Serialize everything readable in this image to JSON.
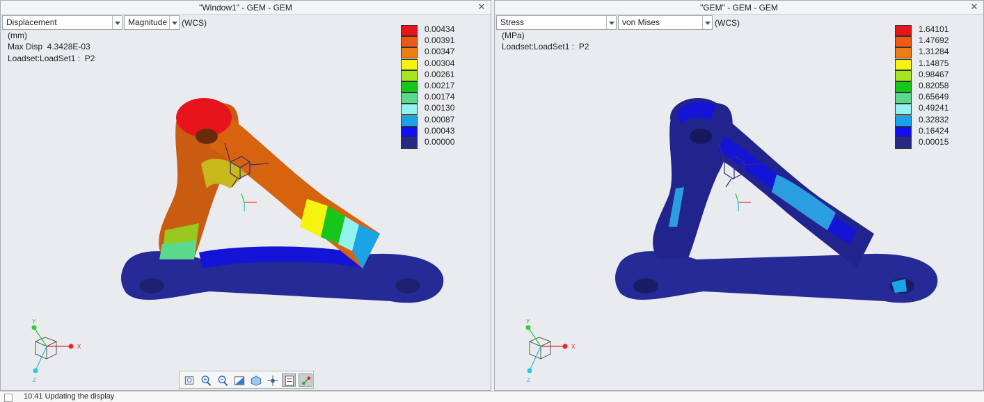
{
  "left": {
    "title": "\"Window1\" - GEM - GEM",
    "quantity": "Displacement",
    "component": "Magnitude",
    "coord_system": "(WCS)",
    "units": "(mm)",
    "max_label": "Max Disp  4.3428E-03",
    "loadset": "Loadset:LoadSet1 :  P2",
    "legend": {
      "values": [
        "0.00434",
        "0.00391",
        "0.00347",
        "0.00304",
        "0.00261",
        "0.00217",
        "0.00174",
        "0.00130",
        "0.00087",
        "0.00043",
        "0.00000"
      ],
      "colors": [
        "#e8141b",
        "#ee5a12",
        "#f07d14",
        "#f6f310",
        "#a4e51d",
        "#16c61b",
        "#5ad98c",
        "#92f2ee",
        "#1aa4e6",
        "#1010ef",
        "#262a86"
      ]
    }
  },
  "right": {
    "title": "\"GEM\" - GEM - GEM",
    "quantity": "Stress",
    "component": "von Mises",
    "coord_system": "(WCS)",
    "units": "(MPa)",
    "loadset": "Loadset:LoadSet1 :  P2",
    "legend": {
      "values": [
        "1.64101",
        "1.47692",
        "1.31284",
        "1.14875",
        "0.98467",
        "0.82058",
        "0.65649",
        "0.49241",
        "0.32832",
        "0.16424",
        "0.00015"
      ],
      "colors": [
        "#e8141b",
        "#ee5a12",
        "#f07d14",
        "#f6f310",
        "#a4e51d",
        "#16c61b",
        "#5ad98c",
        "#92f2ee",
        "#1aa4e6",
        "#1010ef",
        "#262a86"
      ]
    }
  },
  "toolbar": {
    "icons": [
      "refit-icon",
      "zoom-in-icon",
      "zoom-out-icon",
      "repaint-icon",
      "view-orient-icon",
      "spin-center-icon",
      "display-style-icon",
      "datum-display-icon"
    ],
    "active": [
      6,
      7
    ]
  },
  "triad": {
    "x": "X",
    "y": "Y",
    "z": "Z"
  },
  "status": {
    "message": "10:41 Updating the display"
  }
}
